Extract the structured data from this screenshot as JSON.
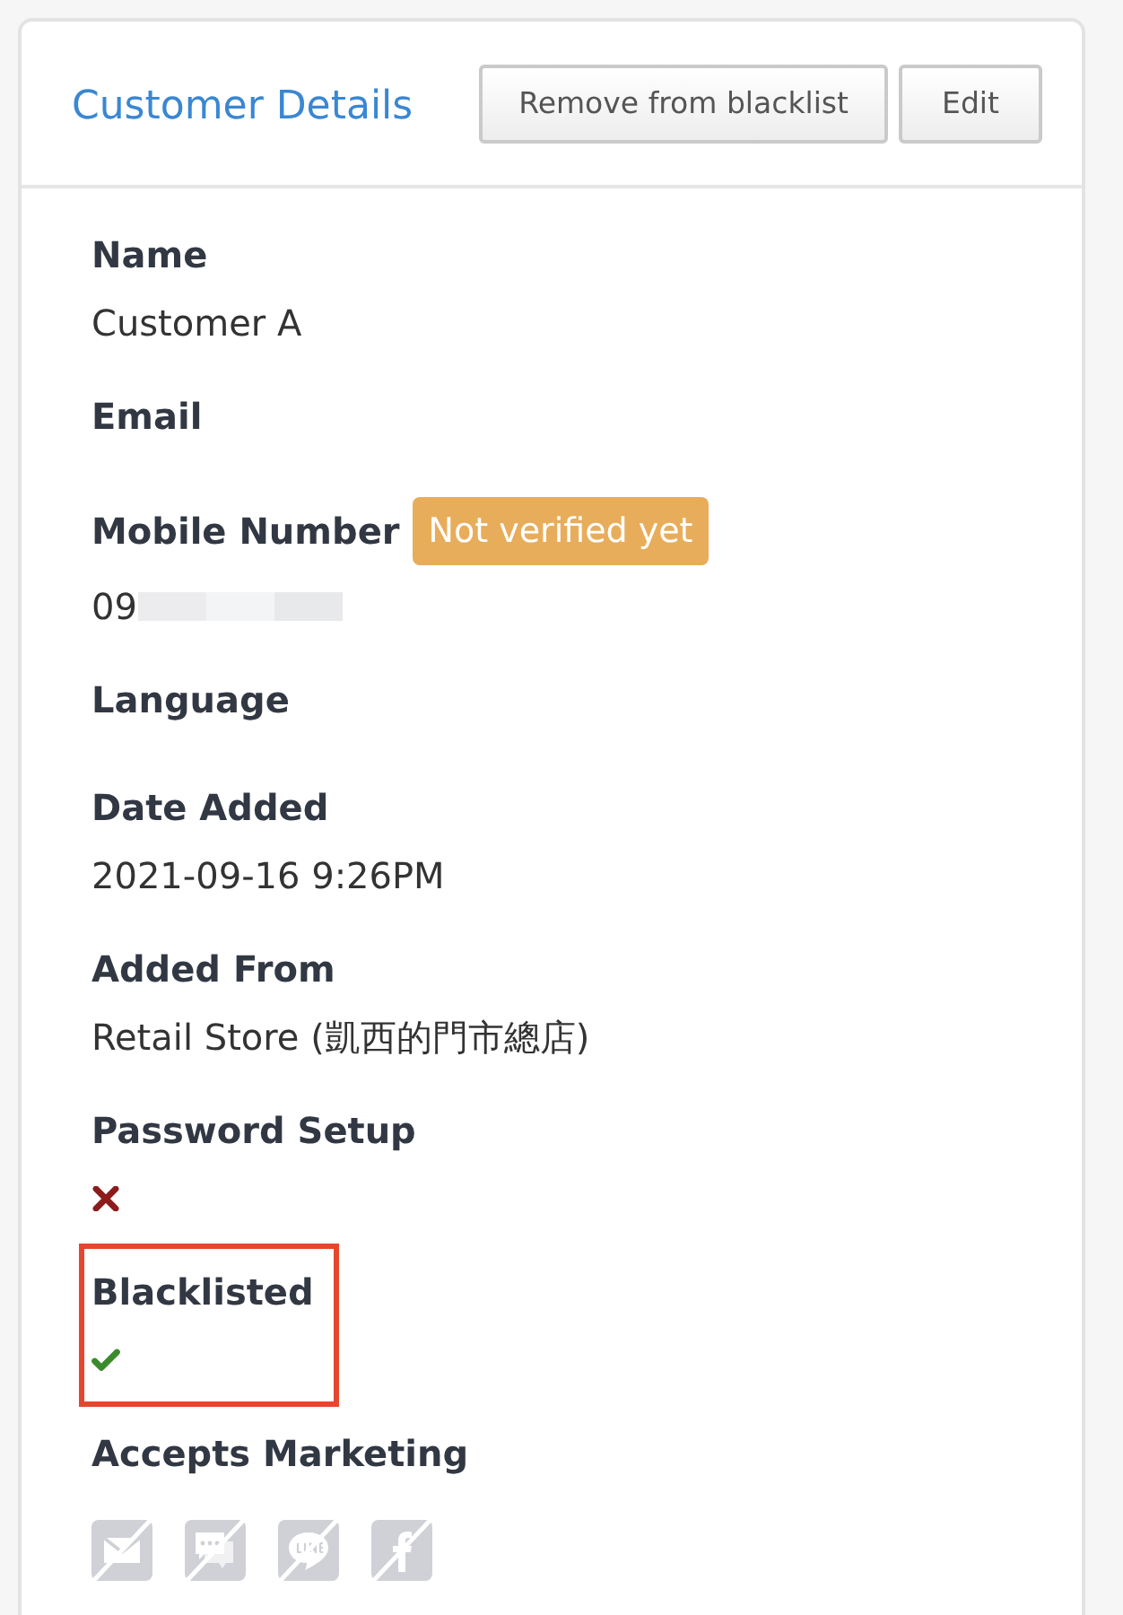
{
  "card": {
    "title": "Customer Details",
    "buttons": [
      {
        "label": "Remove from blacklist"
      },
      {
        "label": "Edit"
      }
    ]
  },
  "fields": [
    {
      "kind": "text",
      "label": "Name",
      "value": "Customer A",
      "highlighted": false
    },
    {
      "kind": "text",
      "label": "Email",
      "highlighted": false
    },
    {
      "kind": "text",
      "label": "Mobile Number",
      "badge": "Not verified yet",
      "value": "09",
      "redacted": true,
      "highlighted": false
    },
    {
      "kind": "text",
      "label": "Language",
      "highlighted": false
    },
    {
      "kind": "text",
      "label": "Date Added",
      "value": "2021-09-16 9:26PM",
      "highlighted": false
    },
    {
      "kind": "text",
      "label": "Added From",
      "value": "Retail Store (凱西的門市總店)",
      "highlighted": false
    },
    {
      "kind": "flag",
      "label": "Password Setup",
      "on": false,
      "highlighted": false
    },
    {
      "kind": "flag",
      "label": "Blacklisted",
      "on": true,
      "highlighted": true
    },
    {
      "kind": "channels",
      "label": "Accepts Marketing",
      "highlighted": false,
      "channels": [
        {
          "kind": "envelope",
          "on": false
        },
        {
          "kind": "chat",
          "on": false
        },
        {
          "kind": "bubble",
          "on": false
        },
        {
          "kind": "letter-f",
          "on": false
        }
      ]
    }
  ]
}
